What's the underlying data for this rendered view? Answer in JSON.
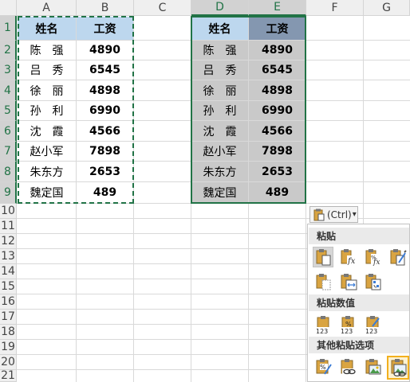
{
  "columns": [
    "A",
    "B",
    "C",
    "D",
    "E",
    "F",
    "G"
  ],
  "rows": [
    "1",
    "2",
    "3",
    "4",
    "5",
    "6",
    "7",
    "8",
    "9",
    "10",
    "11",
    "12",
    "13",
    "14",
    "15",
    "16",
    "17",
    "18",
    "19",
    "20",
    "21"
  ],
  "table_left": {
    "headers": [
      "姓名",
      "工资"
    ],
    "rows": [
      [
        "陈　强",
        "4890"
      ],
      [
        "吕　秀",
        "6545"
      ],
      [
        "徐　丽",
        "4898"
      ],
      [
        "孙　利",
        "6990"
      ],
      [
        "沈　霞",
        "4566"
      ],
      [
        "赵小军",
        "7898"
      ],
      [
        "朱东方",
        "2653"
      ],
      [
        "魏定国",
        "489"
      ]
    ]
  },
  "table_right": {
    "headers": [
      "姓名",
      "工资"
    ],
    "rows": [
      [
        "陈　强",
        "4890"
      ],
      [
        "吕　秀",
        "6545"
      ],
      [
        "徐　丽",
        "4898"
      ],
      [
        "孙　利",
        "6990"
      ],
      [
        "沈　霞",
        "4566"
      ],
      [
        "赵小军",
        "7898"
      ],
      [
        "朱东方",
        "2653"
      ],
      [
        "魏定国",
        "489"
      ]
    ]
  },
  "paste_button": {
    "label": "(Ctrl)",
    "caret": "▾"
  },
  "paste_menu": {
    "sections": [
      {
        "title": "粘贴",
        "icons": [
          "paste-icon",
          "paste-formulas-icon",
          "paste-formulas-number-format-icon",
          "keep-source-formatting-icon",
          "no-borders-icon",
          "keep-column-widths-icon",
          "transpose-icon"
        ]
      },
      {
        "title": "粘贴数值",
        "icons": [
          "paste-values-icon",
          "values-number-format-icon",
          "values-source-formatting-icon"
        ]
      },
      {
        "title": "其他粘贴选项",
        "icons": [
          "formatting-icon",
          "paste-link-icon",
          "picture-icon",
          "linked-picture-icon"
        ]
      }
    ]
  },
  "colors": {
    "accent": "#217346",
    "header_fill": "#bdd7ee",
    "header_fill_dark": "#8497b0",
    "selection_fill": "#c9c9c9",
    "focus_border": "#f2b01e"
  }
}
